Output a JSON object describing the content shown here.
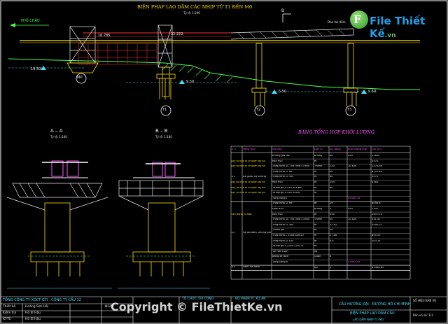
{
  "drawing": {
    "main_title": "BIỆN PHÁP LAO DẦM CÁC NHỊP TỪ T1 ĐẾN M0",
    "main_scale": "Tỷ lệ: 1:200",
    "direction_label": "PHỐ CHÂU",
    "section_marker": "B",
    "elevations": [
      "16.785",
      "32.222",
      "19.50",
      "9.50",
      "5.50",
      "5.50"
    ],
    "pier_labels": [
      "M0",
      "T1",
      "T2",
      "T3"
    ],
    "top_note": "Dàn lao dầm",
    "section_a_title": "A – A",
    "section_a_scale": "Tỷ lệ: 1:100",
    "section_b_title": "B – B",
    "section_b_scale": "Tỷ lệ: 1:100"
  },
  "quantity_table": {
    "title": "BẢNG TỔNG HỢP KHỐI LƯỢNG",
    "headers": [
      "STT",
      "Hạng mục",
      "Vật liệu",
      "Đơn vị",
      "Số lượng",
      "Khối lượng (kg)",
      "Ghi chú"
    ],
    "groups": [
      {
        "no": "01",
        "item": "Đà giáo, hệ khung",
        "rows": [
          [
            "Khung giá lắp",
            "Khung",
            "48",
            "450",
            "21600",
            ""
          ],
          [
            "Ray P43",
            "m",
            "",
            "",
            "3570",
            "Lấy từ kho đi chuyển dự án"
          ],
          [
            "Thép hình 2L 75x75x8 L=800",
            "Thanh",
            "120",
            "10.624",
            "1274.88",
            "Lấy từ kho đi chuyển dự án"
          ],
          [
            "Thép hình I2 H6",
            "m",
            "60",
            "",
            "6720.46",
            ""
          ],
          [
            "Thép hình I2 300",
            "m",
            "40",
            "",
            "1570",
            ""
          ],
          [
            "Ray P43",
            "m",
            "144",
            "",
            "4163",
            "Lấy từ kho đi chuyển dự án"
          ],
          [
            "Tà vẹt gỗ 0.2x0.2x1.8m",
            "m",
            "80",
            "",
            "",
            "Lấy từ kho đi chuyển dự án"
          ],
          [
            "Tà vẹt gỗ 0.2x0.2x2m",
            "m",
            "",
            "",
            "",
            "Lấy từ kho đi chuyển dự án"
          ]
        ],
        "subtotal_label": "Tổng cộng I",
        "subtotal": "55436.34"
      },
      {
        "no": "02",
        "item": "Hệ đà dầm, khung giằng, trụ tạm",
        "rows": [
          [
            "Thép hình I2 H6",
            "m",
            "29",
            "",
            "4444.6",
            ""
          ],
          [
            "Dầm K10",
            "Khung",
            "3",
            "450",
            "1350",
            ""
          ],
          [
            "Ray P43",
            "m",
            "550",
            "",
            "24573.5",
            "Tận dụng từ hợp"
          ],
          [
            "Thép hình 2L 75x75x8 L=800",
            "Thanh",
            "50",
            "10.624",
            "531.42",
            ""
          ],
          [
            "Thép hình I2 300",
            "m",
            "22.92",
            "",
            "1495.07",
            ""
          ],
          [
            "Thanh gỗ",
            "m",
            "28",
            "",
            "",
            ""
          ],
          [
            "Thép hình L 100x100x10",
            "m",
            "37.06",
            "",
            "895.55",
            ""
          ],
          [
            "Thép hình I2 100",
            "m",
            "5.4",
            "",
            "103.24",
            ""
          ],
          [
            "Tà vẹt gỗ 0.22x0.22x1.8",
            "m",
            "",
            "",
            "",
            ""
          ],
          [
            "Tôn sát cuộn",
            "kg",
            "",
            "",
            "",
            ""
          ],
          [
            "Bảng xê dịch",
            "Quần",
            "6",
            "",
            "",
            ""
          ]
        ],
        "subtotal_label": "Tổng cộng II",
        "subtotal": "33993.18"
      },
      {
        "no": "03",
        "item": "Dầm lao dầm",
        "rows": [
          [
            "",
            "Bộ",
            "1",
            "",
            "47464.83",
            ""
          ]
        ]
      }
    ]
  },
  "title_block": {
    "company": "TỔNG CÔNG TY XDCT GTI - CÔNG TY CẦU 12",
    "roles": [
      "Thiết kế",
      "Kiểm tra",
      "KT-TC"
    ],
    "names": [
      "Hoàng Sơn Hải",
      "Hồ Sĩ Hậu",
      "Hồ Sĩ Hậu"
    ],
    "date_label": "NGÀY",
    "stage_label": "TỔ CHỨC THI CÔNG",
    "drawing_no_label": "BỘ PHẬN TC XD ÁN",
    "project_name": "CẦU HƯỚNG ĐẠI - ĐƯỜNG HỒ CHÍ MINH",
    "drawing_title": "BIỆN PHÁP LAO DẦM CẦU",
    "drawing_subtitle": "LAO DẦM NHỊP T1–M0",
    "sheet_label": "SỐ HIỆU BẢN VẼ",
    "sheet_no": "Bản vẽ số: 1/1"
  },
  "branding": {
    "logo_letter": "F",
    "logo_text": "File Thiết Kế",
    "logo_suffix": ".vn",
    "watermark": "Copyright © FileThietKe.vn"
  },
  "colors": {
    "background": "#000000",
    "primary_line": "#ffffff",
    "structure": "#ffe000",
    "annotation": "#40e0ff",
    "steel": "#e8e8e8",
    "highlight": "#ff50ff",
    "ground": "#4cff4c",
    "warn": "#ff3030"
  }
}
